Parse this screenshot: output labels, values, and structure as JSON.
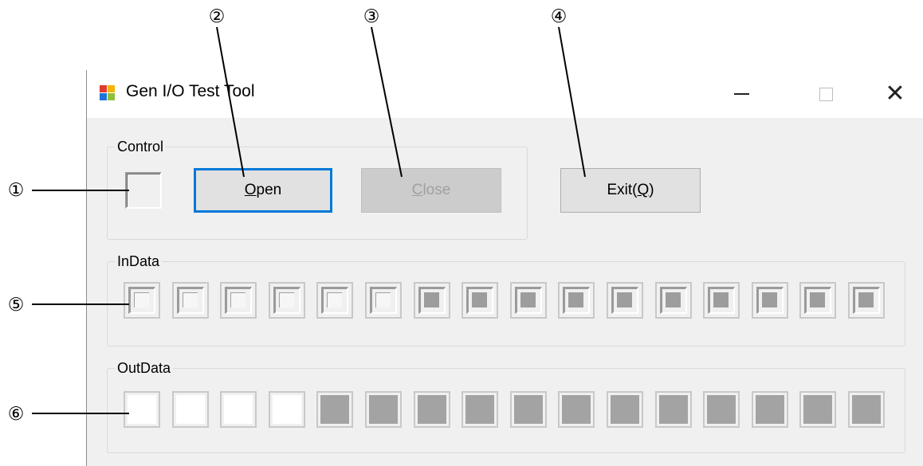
{
  "callouts": [
    "①",
    "②",
    "③",
    "④",
    "⑤",
    "⑥"
  ],
  "window": {
    "title": "Gen I/O Test Tool",
    "controls": {
      "minimize": "—",
      "close": "✕"
    }
  },
  "control_group": {
    "label": "Control",
    "open_button": {
      "mnemonic": "O",
      "rest": "pen"
    },
    "close_button": {
      "mnemonic": "C",
      "rest": "lose"
    },
    "exit_button": {
      "prefix": "Exit(",
      "mnemonic": "Q",
      "suffix": ")"
    }
  },
  "indata": {
    "label": "InData",
    "bits": [
      "off",
      "off",
      "off",
      "off",
      "off",
      "off",
      "on",
      "on",
      "on",
      "on",
      "on",
      "on",
      "on",
      "on",
      "on",
      "on"
    ]
  },
  "outdata": {
    "label": "OutData",
    "bits": [
      "off",
      "off",
      "off",
      "off",
      "on",
      "on",
      "on",
      "on",
      "on",
      "on",
      "on",
      "on",
      "on",
      "on",
      "on",
      "on"
    ]
  },
  "colors": {
    "focus_accent": "#0078d7",
    "led_on": "#9d9d9d",
    "led_off": "#ffffff"
  }
}
